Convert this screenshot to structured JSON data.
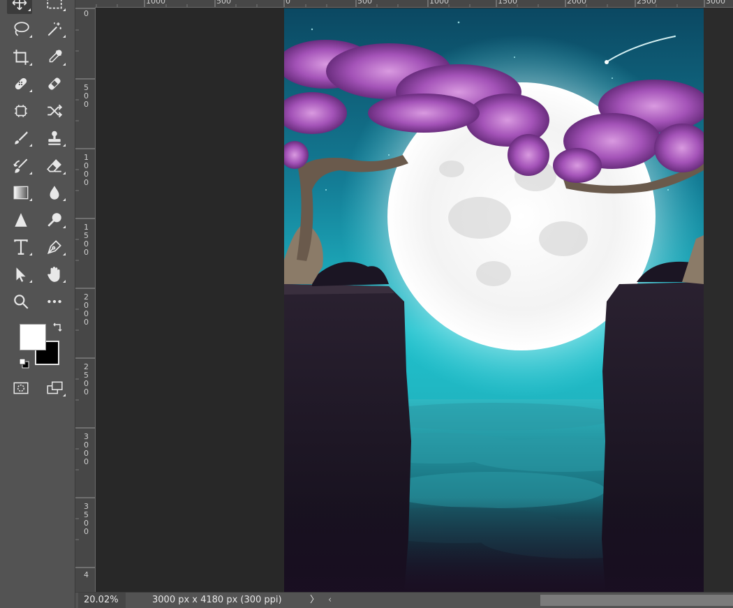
{
  "toolbar": {
    "tools": [
      {
        "name": "move-tool"
      },
      {
        "name": "marquee-tool"
      },
      {
        "name": "lasso-tool"
      },
      {
        "name": "magic-wand-tool"
      },
      {
        "name": "crop-tool"
      },
      {
        "name": "eyedropper-tool"
      },
      {
        "name": "spot-healing-brush-tool"
      },
      {
        "name": "healing-brush-tool"
      },
      {
        "name": "content-aware-move-tool"
      },
      {
        "name": "perspective-warp-tool"
      },
      {
        "name": "brush-tool"
      },
      {
        "name": "clone-stamp-tool"
      },
      {
        "name": "history-brush-tool"
      },
      {
        "name": "eraser-tool"
      },
      {
        "name": "gradient-tool"
      },
      {
        "name": "blur-tool"
      },
      {
        "name": "sharpen-tool"
      },
      {
        "name": "dodge-tool"
      },
      {
        "name": "type-tool"
      },
      {
        "name": "pen-tool"
      },
      {
        "name": "path-selection-tool"
      },
      {
        "name": "hand-tool"
      },
      {
        "name": "zoom-tool"
      },
      {
        "name": "more-tools"
      }
    ],
    "foreground_color": "#ffffff",
    "background_color": "#000000"
  },
  "rulers": {
    "top_labels": [
      "1000",
      "500",
      "0",
      "500",
      "1000",
      "1500",
      "2000",
      "2500",
      "3000"
    ],
    "left_labels": [
      "0",
      "500",
      "1000",
      "1500",
      "2000",
      "2500",
      "3000",
      "3500",
      "4"
    ]
  },
  "statusbar": {
    "zoom": "20.02%",
    "doc_info": "3000 px x 4180 px (300 ppi)",
    "chevron": "〉",
    "scroll_left_arrow": "‹"
  },
  "colors": {
    "toolbar_bg": "#535353",
    "workspace_bg": "#282828",
    "sky_teal": "#1fb6c4",
    "blossom_pink": "#b56bc4"
  }
}
